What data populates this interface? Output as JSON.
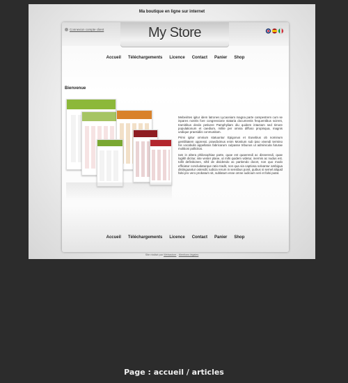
{
  "tagline": "Ma boutique en ligne sur internet",
  "header": {
    "logo": "My Store",
    "login_link": "Connexion compte client",
    "flags": [
      "flag-uk-icon",
      "flag-es-icon",
      "flag-it-icon"
    ]
  },
  "nav": {
    "items": [
      "Accueil",
      "Téléchargements",
      "Licence",
      "Contact",
      "Panier",
      "Shop"
    ]
  },
  "main": {
    "welcome": "Bienvenue",
    "paragraphs": [
      "Mebeirites igitur idem latrones Lycaoniam magna parte campestrem cum se inpares nostris fore congressione stataria documentis frequentibus scirent, tramitibus deviis petivere Pamphyliam diu quidem intactam sed timore populationum et caedium, milite per omnia diffuso propinqua, magnis undique praesidiis conmunitam.",
      "Primi igitur omnium statuuntur Epigonus et Eusebius ob nominum gentilitatem oppressi. praediximus enim Montium sub ipso vivendi termino his vocabulis appellatos fabricarum culpasse tribunos ut adminicula futurae molitioni pollicitos.",
      "Iam in altera philosophiae parte, quae est quaerendi ac disserendi, quae logikh dicitur, iste vester plane, ut mihi quidem videtur, inermis ac nudus est. tollit definitiones, nihil de dividendo ac partiendo docet, non quo modo efficiatur concludaturque ratio tradit, non qua via captiosa solvantur ambigua distinguantur ostendit; iudicia rerum in sensibus ponit, quibus si semel aliquid falsi pro vero probatum sit, sublatum esse omne iudicium veri et falsi putat."
    ]
  },
  "footer": {
    "prefix": "Site réalisé par",
    "link1": "Webastore",
    "separator": " - ",
    "link2": "Mentions légales"
  },
  "caption": "Page : accueil / articles",
  "colors": {
    "page_bg": "#2c2c2c",
    "accent_green": "#8cb83a",
    "accent_orange": "#d9822b",
    "accent_red": "#8f1d22"
  }
}
